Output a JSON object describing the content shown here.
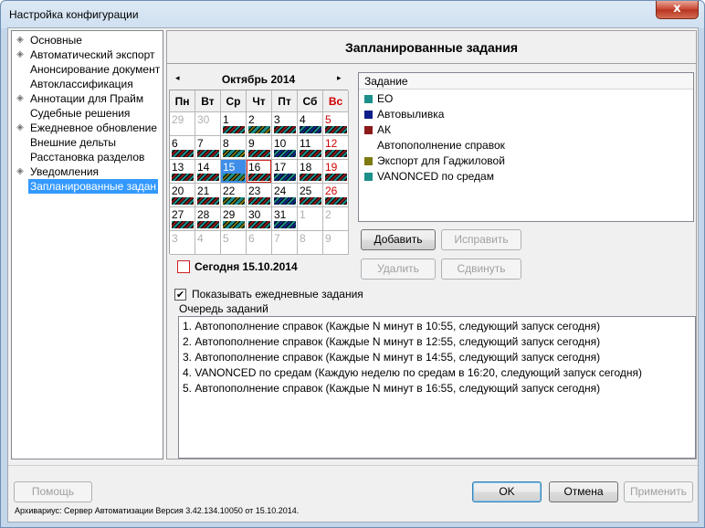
{
  "window": {
    "title": "Настройка конфигурации",
    "close_glyph": "x"
  },
  "tree": {
    "items": [
      {
        "label": "Основные",
        "expandable": true
      },
      {
        "label": "Автоматический экспорт",
        "expandable": true
      },
      {
        "label": "Анонсирование документ",
        "expandable": false
      },
      {
        "label": "Автоклассификация",
        "expandable": false
      },
      {
        "label": "Аннотации для Прайм",
        "expandable": true
      },
      {
        "label": "Судебные решения",
        "expandable": false
      },
      {
        "label": "Ежедневное обновление",
        "expandable": true
      },
      {
        "label": "Внешние дельты",
        "expandable": false
      },
      {
        "label": "Расстановка разделов",
        "expandable": false
      },
      {
        "label": "Уведомления",
        "expandable": true
      },
      {
        "label": "Запланированные задан",
        "expandable": false,
        "selected": true
      }
    ]
  },
  "panel": {
    "title": "Запланированные задания"
  },
  "calendar": {
    "prev_glyph": "◂",
    "next_glyph": "▸",
    "month": "Октябрь 2014",
    "weekdays": [
      "Пн",
      "Вт",
      "Ср",
      "Чт",
      "Пт",
      "Сб",
      "Вс"
    ],
    "weeks": [
      [
        {
          "d": "29",
          "o": true
        },
        {
          "d": "30",
          "o": true
        },
        {
          "d": "1",
          "m": "c1"
        },
        {
          "d": "2",
          "m": "c2"
        },
        {
          "d": "3",
          "m": "c1"
        },
        {
          "d": "4",
          "m": "c3"
        },
        {
          "d": "5",
          "m": "c1"
        }
      ],
      [
        {
          "d": "6",
          "m": "c1"
        },
        {
          "d": "7",
          "m": "c1"
        },
        {
          "d": "8",
          "m": "c2"
        },
        {
          "d": "9",
          "m": "c1"
        },
        {
          "d": "10",
          "m": "c3"
        },
        {
          "d": "11",
          "m": "c1"
        },
        {
          "d": "12",
          "m": "c1"
        }
      ],
      [
        {
          "d": "13",
          "m": "c1"
        },
        {
          "d": "14",
          "m": "c1"
        },
        {
          "d": "15",
          "m": "c2",
          "today": true
        },
        {
          "d": "16",
          "m": "c1",
          "outlined": true
        },
        {
          "d": "17",
          "m": "c3"
        },
        {
          "d": "18",
          "m": "c1"
        },
        {
          "d": "19",
          "m": "c1"
        }
      ],
      [
        {
          "d": "20",
          "m": "c1"
        },
        {
          "d": "21",
          "m": "c1"
        },
        {
          "d": "22",
          "m": "c2"
        },
        {
          "d": "23",
          "m": "c1"
        },
        {
          "d": "24",
          "m": "c3"
        },
        {
          "d": "25",
          "m": "c1"
        },
        {
          "d": "26",
          "m": "c1"
        }
      ],
      [
        {
          "d": "27",
          "m": "c1"
        },
        {
          "d": "28",
          "m": "c1"
        },
        {
          "d": "29",
          "m": "c2"
        },
        {
          "d": "30",
          "m": "c1"
        },
        {
          "d": "31",
          "m": "c3"
        },
        {
          "d": "1",
          "o": true
        },
        {
          "d": "2",
          "o": true
        }
      ],
      [
        {
          "d": "3",
          "o": true
        },
        {
          "d": "4",
          "o": true
        },
        {
          "d": "5",
          "o": true
        },
        {
          "d": "6",
          "o": true
        },
        {
          "d": "7",
          "o": true
        },
        {
          "d": "8",
          "o": true
        },
        {
          "d": "9",
          "o": true
        }
      ]
    ],
    "today_label": "Сегодня 15.10.2014"
  },
  "tasks": {
    "header": "Задание",
    "items": [
      {
        "label": "ЕО",
        "color": "#1d8f8a"
      },
      {
        "label": "Автовыливка",
        "color": "#0e1f8a"
      },
      {
        "label": "АК",
        "color": "#8b1a1a"
      },
      {
        "label": "Автопополнение справок",
        "color": ""
      },
      {
        "label": "Экспорт для Гаджиловой",
        "color": "#7d7a12"
      },
      {
        "label": "VANONCED по средам",
        "color": "#1d8f8a"
      }
    ]
  },
  "buttons": {
    "add": "Добавить",
    "edit": "Исправить",
    "delete": "Удалить",
    "move": "Сдвинуть",
    "help": "Помощь",
    "ok": "OK",
    "cancel": "Отмена",
    "apply": "Применить"
  },
  "show_daily": {
    "label": "Показывать ежедневные задания",
    "checked": true,
    "mark": "✔"
  },
  "queue": {
    "label": "Очередь заданий",
    "items": [
      "1. Автопополнение справок (Каждые N минут в 10:55, следующий запуск сегодня)",
      "2. Автопополнение справок (Каждые N минут в 12:55, следующий запуск сегодня)",
      "3. Автопополнение справок (Каждые N минут в 14:55, следующий запуск сегодня)",
      "4. VANONCED по средам (Каждую неделю по средам в 16:20, следующий запуск сегодня)",
      "5. Автопополнение справок (Каждые N минут в 16:55, следующий запуск сегодня)"
    ]
  },
  "status": {
    "text": "Архивариус: Сервер Автоматизации Версия 3.42.134.10050 от 15.10.2014."
  }
}
